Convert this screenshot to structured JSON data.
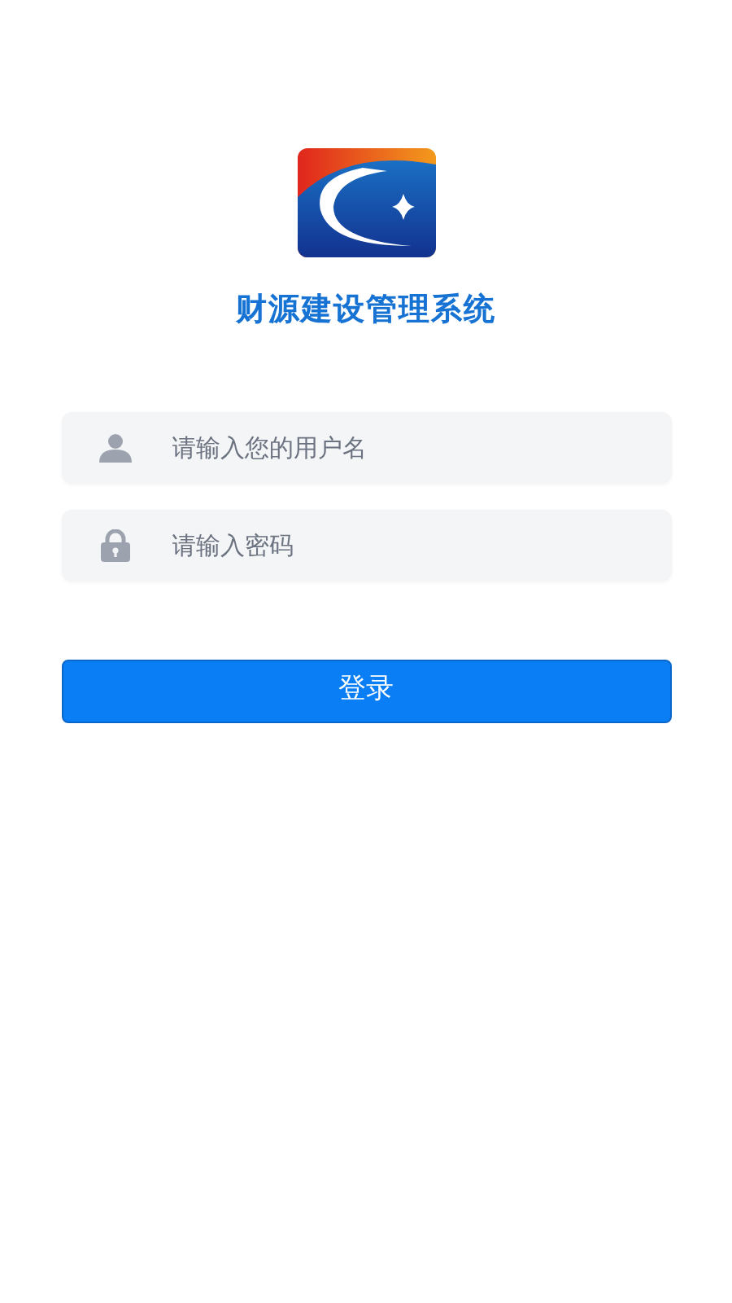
{
  "app": {
    "title": "财源建设管理系统"
  },
  "fields": [
    {
      "kind": "username",
      "placeholder": "请输入您的用户名"
    },
    {
      "kind": "password",
      "placeholder": "请输入密码"
    }
  ],
  "login_button": {
    "label": "登录"
  }
}
